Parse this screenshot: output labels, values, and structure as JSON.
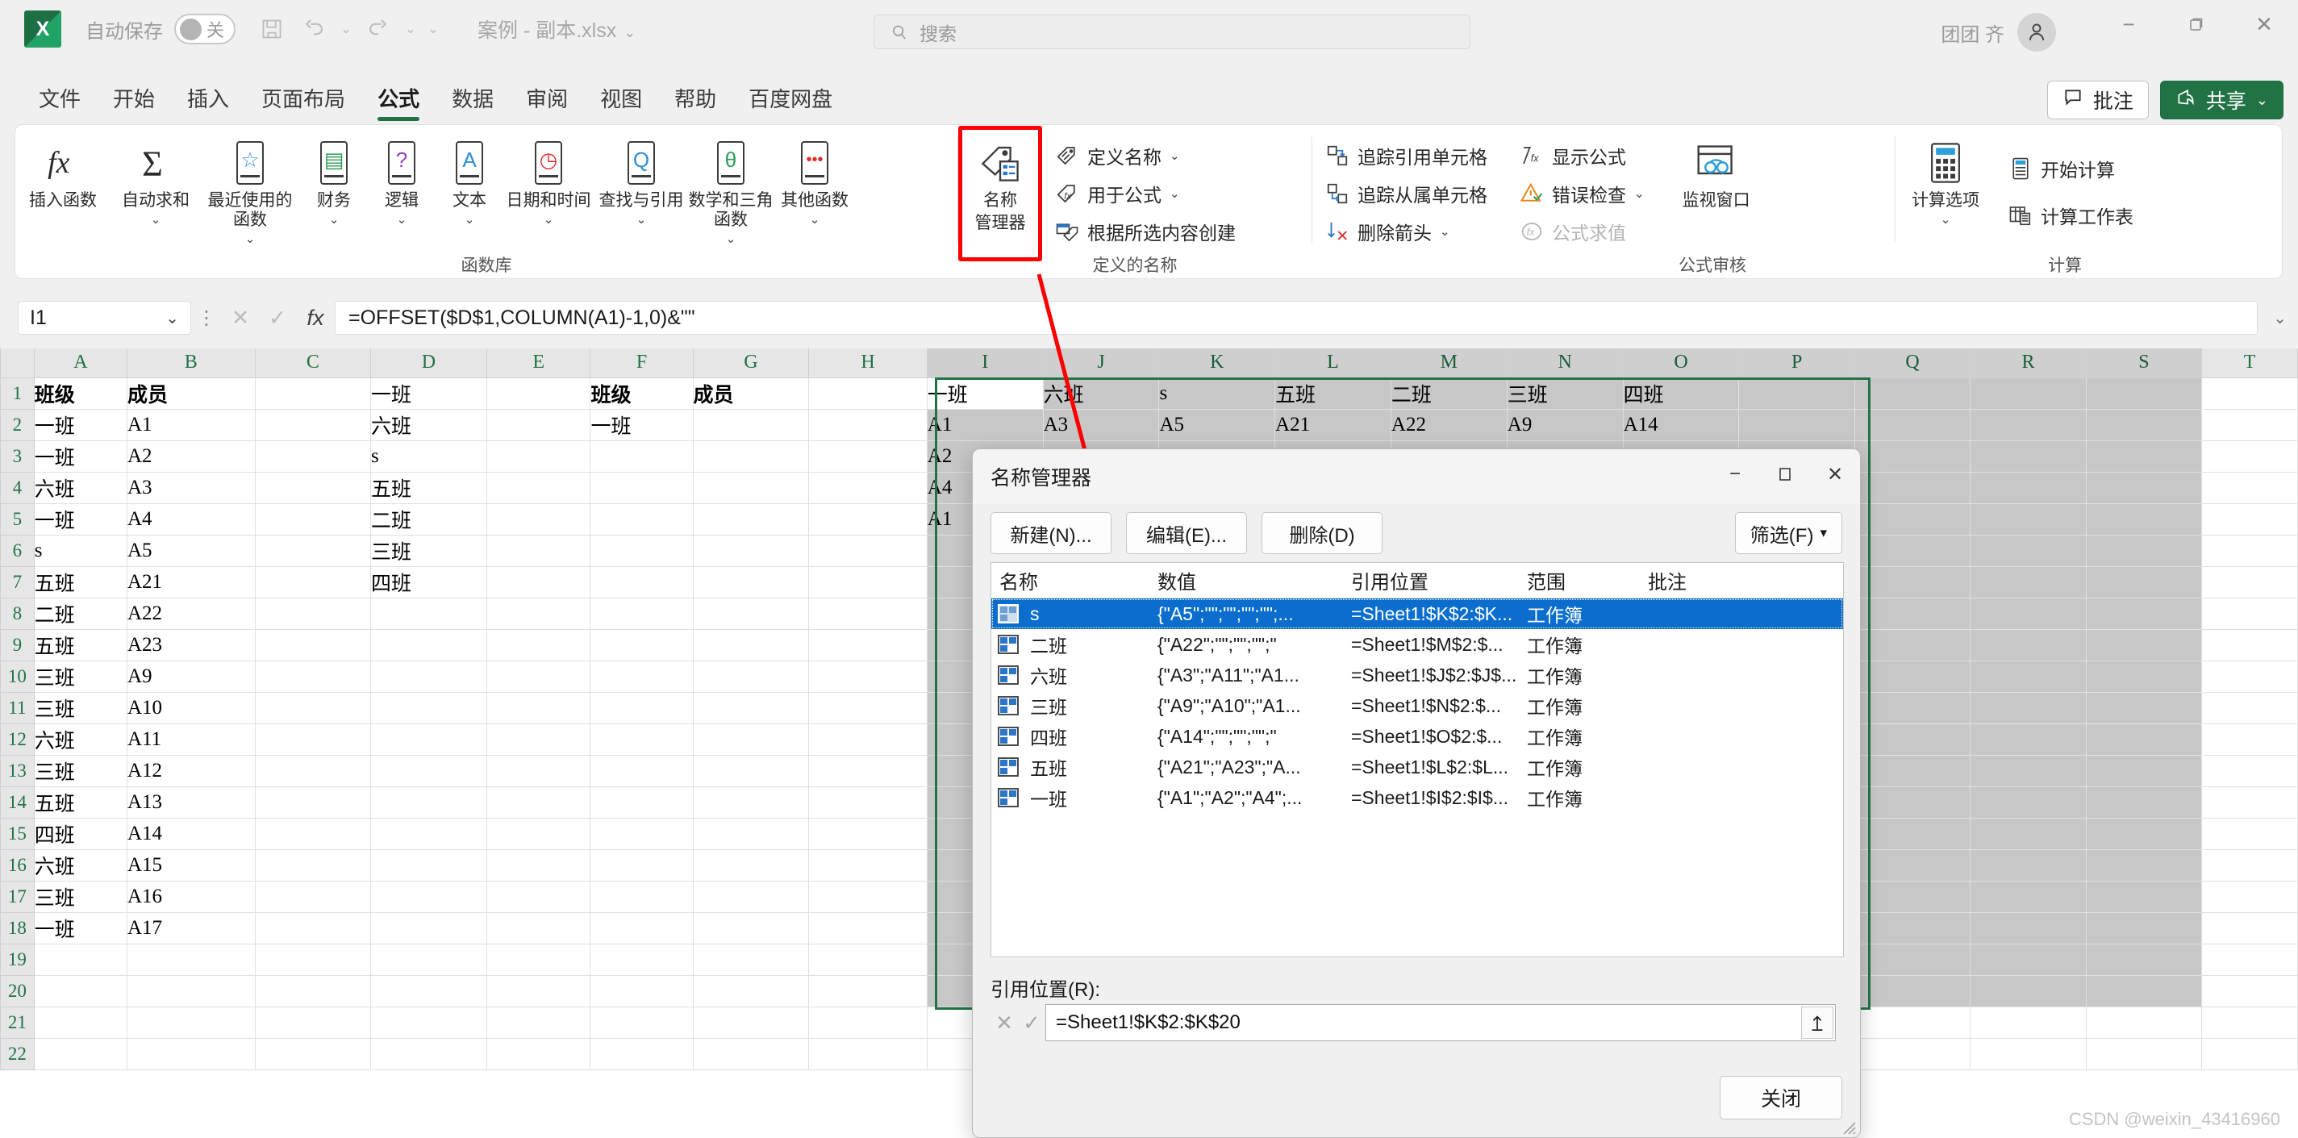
{
  "titlebar": {
    "autosave_label": "自动保存",
    "autosave_state": "关",
    "doc_title": "案例 - 副本.xlsx",
    "account_name": "团团 齐",
    "qat": [
      "save-icon",
      "undo-icon",
      "redo-icon",
      "customize-icon"
    ]
  },
  "search": {
    "placeholder": "搜索"
  },
  "tabs": [
    {
      "label": "文件"
    },
    {
      "label": "开始"
    },
    {
      "label": "插入"
    },
    {
      "label": "页面布局"
    },
    {
      "label": "公式"
    },
    {
      "label": "数据"
    },
    {
      "label": "审阅"
    },
    {
      "label": "视图"
    },
    {
      "label": "帮助"
    },
    {
      "label": "百度网盘"
    }
  ],
  "active_tab": "公式",
  "top_right_buttons": {
    "note": "批注",
    "share": "共享"
  },
  "ribbon": {
    "groups": [
      {
        "title": "函数库",
        "big_buttons": [
          {
            "label": "插入函数",
            "icon": "fx-icon",
            "caret": false
          },
          {
            "label": "自动求和",
            "icon": "sigma-icon",
            "caret": true
          },
          {
            "label": "最近使用的函数",
            "icon": "recent-star-icon",
            "caret": true
          },
          {
            "label": "财务",
            "icon": "finance-coins-icon",
            "caret": true
          },
          {
            "label": "逻辑",
            "icon": "logical-question-icon",
            "caret": true
          },
          {
            "label": "文本",
            "icon": "text-a-icon",
            "caret": true
          },
          {
            "label": "日期和时间",
            "icon": "clock-icon",
            "caret": true
          },
          {
            "label": "查找与引用",
            "icon": "lookup-magnifier-icon",
            "caret": true
          },
          {
            "label": "数学和三角函数",
            "icon": "math-theta-icon",
            "caret": true
          },
          {
            "label": "其他函数",
            "icon": "more-dots-icon",
            "caret": true
          }
        ]
      },
      {
        "title": "定义的名称",
        "name_manager": {
          "label_line1": "名称",
          "label_line2": "管理器",
          "icon": "name-manager-tag-icon",
          "highlighted": true
        },
        "small_buttons": [
          {
            "label": "定义名称",
            "icon": "define-name-icon",
            "caret": true
          },
          {
            "label": "用于公式",
            "icon": "use-in-formula-icon",
            "caret": true
          },
          {
            "label": "根据所选内容创建",
            "icon": "create-from-selection-icon",
            "caret": false
          }
        ]
      },
      {
        "title": "公式审核",
        "small_buttons_left": [
          {
            "label": "追踪引用单元格",
            "icon": "trace-precedents-icon",
            "caret": false
          },
          {
            "label": "追踪从属单元格",
            "icon": "trace-dependents-icon",
            "caret": false
          },
          {
            "label": "删除箭头",
            "icon": "remove-arrows-icon",
            "caret": true
          }
        ],
        "small_buttons_right": [
          {
            "label": "显示公式",
            "icon": "show-formulas-icon",
            "caret": false,
            "disabled": false
          },
          {
            "label": "错误检查",
            "icon": "error-check-icon",
            "caret": true,
            "disabled": false
          },
          {
            "label": "公式求值",
            "icon": "evaluate-formula-icon",
            "caret": false,
            "disabled": true
          }
        ],
        "watch_window": {
          "label": "监视窗口",
          "icon": "watch-window-icon"
        }
      },
      {
        "title": "计算",
        "calc_options": {
          "label": "计算选项",
          "icon": "calc-options-icon",
          "caret": true
        },
        "small_buttons": [
          {
            "label": "开始计算",
            "icon": "calculate-now-icon"
          },
          {
            "label": "计算工作表",
            "icon": "calculate-sheet-icon"
          }
        ]
      }
    ]
  },
  "formula_bar": {
    "name_box": "I1",
    "formula": "=OFFSET($D$1,COLUMN(A1)-1,0)&\"\"",
    "cancel_icon": "cancel-x-icon",
    "confirm_icon": "confirm-check-icon",
    "fx_icon": "fx-icon",
    "expand_icon": "expand-chevron-icon"
  },
  "grid": {
    "columns": [
      "A",
      "B",
      "C",
      "D",
      "E",
      "F",
      "G",
      "H",
      "I",
      "J",
      "K",
      "L",
      "M",
      "N",
      "O",
      "P",
      "Q",
      "R",
      "S",
      "T"
    ],
    "selected_columns": [
      "I",
      "J",
      "K",
      "L",
      "M",
      "N",
      "O",
      "P",
      "Q",
      "R",
      "S"
    ],
    "rows": [
      "1",
      "2",
      "3",
      "4",
      "5",
      "6",
      "7",
      "8",
      "9",
      "10",
      "11",
      "12",
      "13",
      "14",
      "15",
      "16",
      "17",
      "18",
      "19",
      "20",
      "21",
      "22"
    ],
    "cells": {
      "A1": "班级",
      "B1": "成员",
      "D1": "一班",
      "F1": "班级",
      "G1": "成员",
      "I1": "一班",
      "J1": "六班",
      "K1": "s",
      "L1": "五班",
      "M1": "二班",
      "N1": "三班",
      "O1": "四班",
      "A2": "一班",
      "B2": "A1",
      "D2": "六班",
      "F2": "一班",
      "I2": "A1",
      "J2": "A3",
      "K2": "A5",
      "L2": "A21",
      "M2": "A22",
      "N2": "A9",
      "O2": "A14",
      "A3": "一班",
      "B3": "A2",
      "D3": "s",
      "I3": "A2",
      "A4": "六班",
      "B4": "A3",
      "D4": "五班",
      "I4": "A4",
      "A5": "一班",
      "B5": "A4",
      "D5": "二班",
      "I5": "A1",
      "A6": "s",
      "B6": "A5",
      "D6": "三班",
      "A7": "五班",
      "B7": "A21",
      "D7": "四班",
      "A8": "二班",
      "B8": "A22",
      "A9": "五班",
      "B9": "A23",
      "A10": "三班",
      "B10": "A9",
      "A11": "三班",
      "B11": "A10",
      "A12": "六班",
      "B12": "A11",
      "A13": "三班",
      "B13": "A12",
      "A14": "五班",
      "B14": "A13",
      "A15": "四班",
      "B15": "A14",
      "A16": "六班",
      "B16": "A15",
      "A17": "三班",
      "B17": "A16",
      "A18": "一班",
      "B18": "A17"
    }
  },
  "dialog": {
    "title": "名称管理器",
    "window_buttons": {
      "minimize": "−",
      "maximize": "❐",
      "close": "✕"
    },
    "toolbar": {
      "new": "新建(N)...",
      "new_key": "N",
      "edit": "编辑(E)...",
      "edit_key": "E",
      "delete": "删除(D)",
      "delete_key": "D",
      "filter": "筛选(F)",
      "filter_key": "F"
    },
    "table": {
      "headers": [
        "名称",
        "数值",
        "引用位置",
        "范围",
        "批注"
      ],
      "rows": [
        {
          "name": "s",
          "value": "{\"A5\";\"\";\"\";\"\";\"\";...",
          "refers_to": "=Sheet1!$K$2:$K...",
          "scope": "工作簿",
          "comment": "",
          "selected": true
        },
        {
          "name": "二班",
          "value": "{\"A22\";\"\";\"\";\"\";\"",
          "refers_to": "=Sheet1!$M$2:$...",
          "scope": "工作簿",
          "comment": "",
          "selected": false
        },
        {
          "name": "六班",
          "value": "{\"A3\";\"A11\";\"A1...",
          "refers_to": "=Sheet1!$J$2:$J$...",
          "scope": "工作簿",
          "comment": "",
          "selected": false
        },
        {
          "name": "三班",
          "value": "{\"A9\";\"A10\";\"A1...",
          "refers_to": "=Sheet1!$N$2:$...",
          "scope": "工作簿",
          "comment": "",
          "selected": false
        },
        {
          "name": "四班",
          "value": "{\"A14\";\"\";\"\";\"\";\"",
          "refers_to": "=Sheet1!$O$2:$...",
          "scope": "工作簿",
          "comment": "",
          "selected": false
        },
        {
          "name": "五班",
          "value": "{\"A21\";\"A23\";\"A...",
          "refers_to": "=Sheet1!$L$2:$L...",
          "scope": "工作簿",
          "comment": "",
          "selected": false
        },
        {
          "name": "一班",
          "value": "{\"A1\";\"A2\";\"A4\";...",
          "refers_to": "=Sheet1!$I$2:$I$...",
          "scope": "工作簿",
          "comment": "",
          "selected": false
        }
      ]
    },
    "refers_to": {
      "label": "引用位置(R):",
      "label_key": "R",
      "value": "=Sheet1!$K$2:$K$20",
      "cancel_icon": "cancel-x-icon",
      "confirm_icon": "confirm-check-icon",
      "collapse_icon": "collapse-dialog-icon"
    },
    "close_button": "关闭"
  },
  "annotation": {
    "arrow_color": "#ff0000"
  },
  "watermark": "CSDN @weixin_43416960"
}
